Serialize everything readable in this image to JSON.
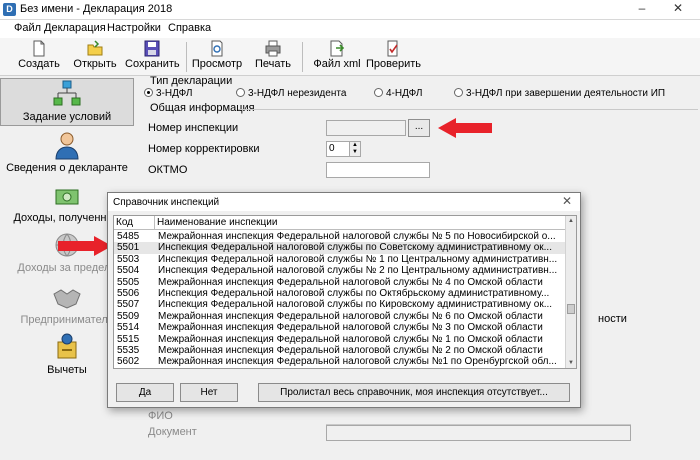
{
  "window": {
    "title": "Без имени - Декларация 2018",
    "app_icon": "D",
    "minimize": "–",
    "close": "✕"
  },
  "menu": [
    "Файл",
    "Декларация",
    "Настройки",
    "Справка"
  ],
  "toolbar": {
    "create": "Создать",
    "open": "Открыть",
    "save": "Сохранить",
    "preview": "Просмотр",
    "print": "Печать",
    "file_xml": "Файл xml",
    "check": "Проверить"
  },
  "sidebar": {
    "items": [
      {
        "label": "Задание условий"
      },
      {
        "label": "Сведения о декларанте"
      },
      {
        "label": "Доходы, полученные"
      },
      {
        "label": "Доходы за предело"
      },
      {
        "label": "Предприниматель"
      },
      {
        "label": "Вычеты"
      }
    ]
  },
  "main": {
    "declaration_type_label": "Тип декларации",
    "types": [
      {
        "label": "3-НДФЛ",
        "selected": true
      },
      {
        "label": "3-НДФЛ нерезидента",
        "selected": false
      },
      {
        "label": "4-НДФЛ",
        "selected": false
      },
      {
        "label": "3-НДФЛ при завершении деятельности ИП",
        "selected": false
      }
    ],
    "general_info_label": "Общая информация",
    "inspection_number_label": "Номер инспекции",
    "inspection_number_value": "",
    "browse_label": "...",
    "correction_number_label": "Номер корректировки",
    "correction_number_value": "0",
    "oktmo_label": "ОКТМО",
    "oktmo_value": "",
    "partial_text_right": "ности",
    "fio_label": "ФИО",
    "document_label": "Документ"
  },
  "dialog": {
    "title": "Справочник инспекций",
    "col_code": "Код",
    "col_name": "Наименование инспекции",
    "rows": [
      {
        "code": "5485",
        "name": "Межрайонная инспекция Федеральной налоговой службы № 5 по Новосибирской о..."
      },
      {
        "code": "5501",
        "name": "Инспекция Федеральной налоговой службы по Советскому административному ок..."
      },
      {
        "code": "5503",
        "name": "Инспекция Федеральной налоговой службы № 1 по Центральному административн..."
      },
      {
        "code": "5504",
        "name": "Инспекция Федеральной налоговой службы № 2 по Центральному административн..."
      },
      {
        "code": "5505",
        "name": "Межрайонная инспекция Федеральной налоговой службы № 4 по Омской области"
      },
      {
        "code": "5506",
        "name": "Инспекция Федеральной налоговой службы по Октябрьскому административному..."
      },
      {
        "code": "5507",
        "name": "Инспекция Федеральной налоговой службы по Кировскому административному ок..."
      },
      {
        "code": "5509",
        "name": "Межрайонная инспекция Федеральной налоговой службы № 6 по Омской области"
      },
      {
        "code": "5514",
        "name": "Межрайонная инспекция Федеральной налоговой службы № 3 по Омской области"
      },
      {
        "code": "5515",
        "name": "Межрайонная инспекция Федеральной налоговой службы № 1 по Омской области"
      },
      {
        "code": "5535",
        "name": "Межрайонная инспекция Федеральной налоговой службы № 2 по Омской области"
      },
      {
        "code": "5602",
        "name": "Межрайонная инспекция Федеральной налоговой службы №1 по Оренбургской обл..."
      }
    ],
    "selected_index": 1,
    "yes": "Да",
    "no": "Нет",
    "scrolled": "Пролистал весь справочник, моя инспекция отсутствует..."
  },
  "colors": {
    "arrow": "#e8222a",
    "selection": "#e6e6e6",
    "sidebar_active": "#dcdcdc"
  }
}
